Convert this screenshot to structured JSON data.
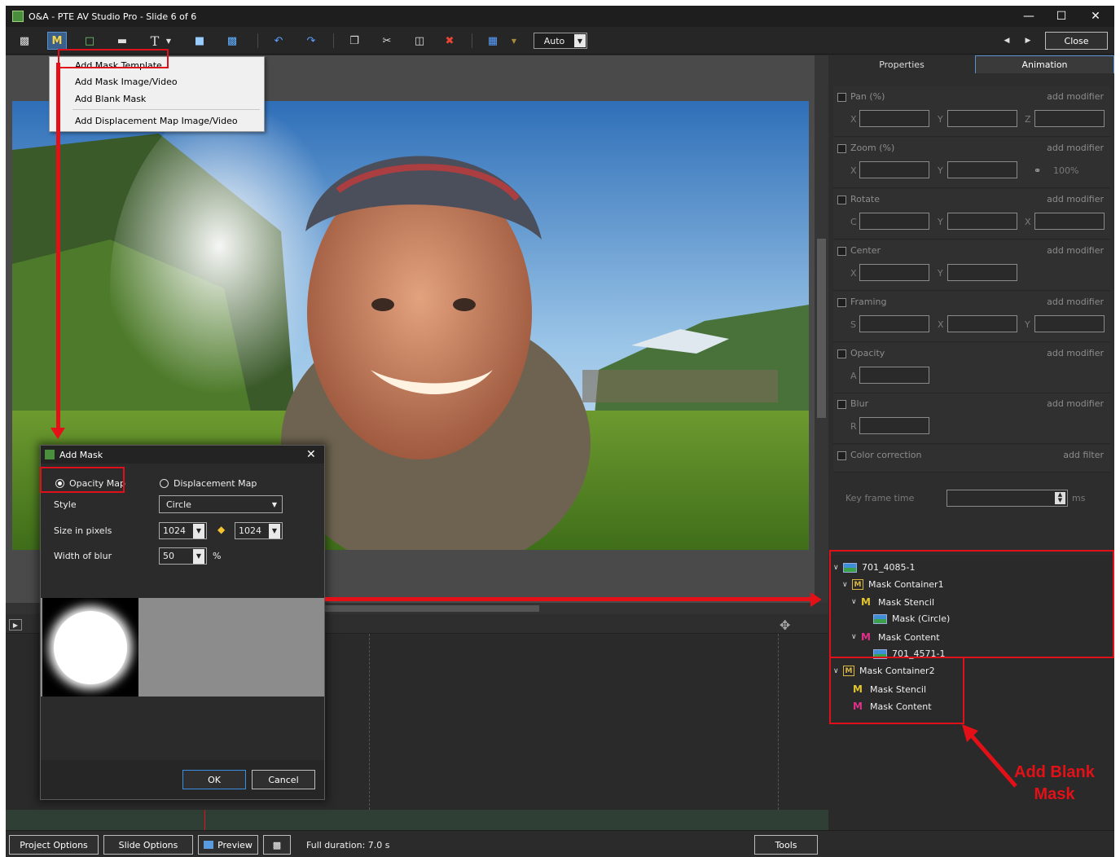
{
  "window": {
    "title": "O&A - PTE AV Studio Pro - Slide 6 of 6"
  },
  "toolbar": {
    "auto_value": "Auto",
    "close_label": "Close",
    "mask_button_glyph": "M",
    "text_button_glyph": "T"
  },
  "menu": {
    "items": [
      "Add Mask Template",
      "Add Mask Image/Video",
      "Add Blank Mask",
      "Add Displacement Map Image/Video"
    ]
  },
  "dialog": {
    "title": "Add Mask",
    "opacity_map_label": "Opacity Map",
    "displacement_map_label": "Displacement Map",
    "style_label": "Style",
    "style_value": "Circle",
    "size_label": "Size in pixels",
    "size_w": "1024",
    "size_h": "1024",
    "blur_label": "Width of blur",
    "blur_value": "50",
    "blur_unit": "%",
    "ok_label": "OK",
    "cancel_label": "Cancel"
  },
  "panel": {
    "tabs": [
      "Properties",
      "Animation"
    ],
    "active_tab": "Animation",
    "rows": [
      {
        "label": "Pan (%)",
        "modifier": "add modifier",
        "axes": [
          "X",
          "Y",
          "Z"
        ]
      },
      {
        "label": "Zoom (%)",
        "modifier": "add modifier",
        "axes": [
          "X",
          "Y"
        ],
        "extra": "100%"
      },
      {
        "label": "Rotate",
        "modifier": "add modifier",
        "axes": [
          "C",
          "Y",
          "X"
        ]
      },
      {
        "label": "Center",
        "modifier": "add modifier",
        "axes": [
          "X",
          "Y"
        ]
      },
      {
        "label": "Framing",
        "modifier": "add modifier",
        "axes": [
          "S",
          "X",
          "Y"
        ]
      },
      {
        "label": "Opacity",
        "modifier": "add modifier",
        "axes": [
          "A"
        ]
      },
      {
        "label": "Blur",
        "modifier": "add modifier",
        "axes": [
          "R"
        ]
      }
    ],
    "color_correction": {
      "label": "Color correction",
      "filter": "add filter"
    },
    "key_frame_label": "Key frame time",
    "key_frame_unit": "ms"
  },
  "tree": {
    "nodes": [
      "701_4085-1",
      "Mask Container1",
      "Mask Stencil",
      "Mask (Circle)",
      "Mask Content",
      "701_4571-1",
      "Mask Container2",
      "Mask Stencil",
      "Mask Content"
    ]
  },
  "statusbar": {
    "project_options": "Project Options",
    "slide_options": "Slide Options",
    "preview": "Preview",
    "duration": "Full duration: 7.0 s",
    "tools": "Tools"
  },
  "annotation": {
    "line1": "Add Blank",
    "line2": "Mask"
  },
  "colors": {
    "accent_red": "#e41017",
    "dark_bg": "#2b2b2b",
    "menu_bg": "#f0f0f0"
  },
  "icons": [
    "camera-icon",
    "mask-icon",
    "frame-icon",
    "video-icon",
    "text-icon",
    "rectangle-icon",
    "image-icon",
    "undo-icon",
    "redo-icon",
    "copy-icon",
    "cut-icon",
    "paste-icon",
    "delete-icon",
    "grid-icon",
    "move-icon"
  ]
}
